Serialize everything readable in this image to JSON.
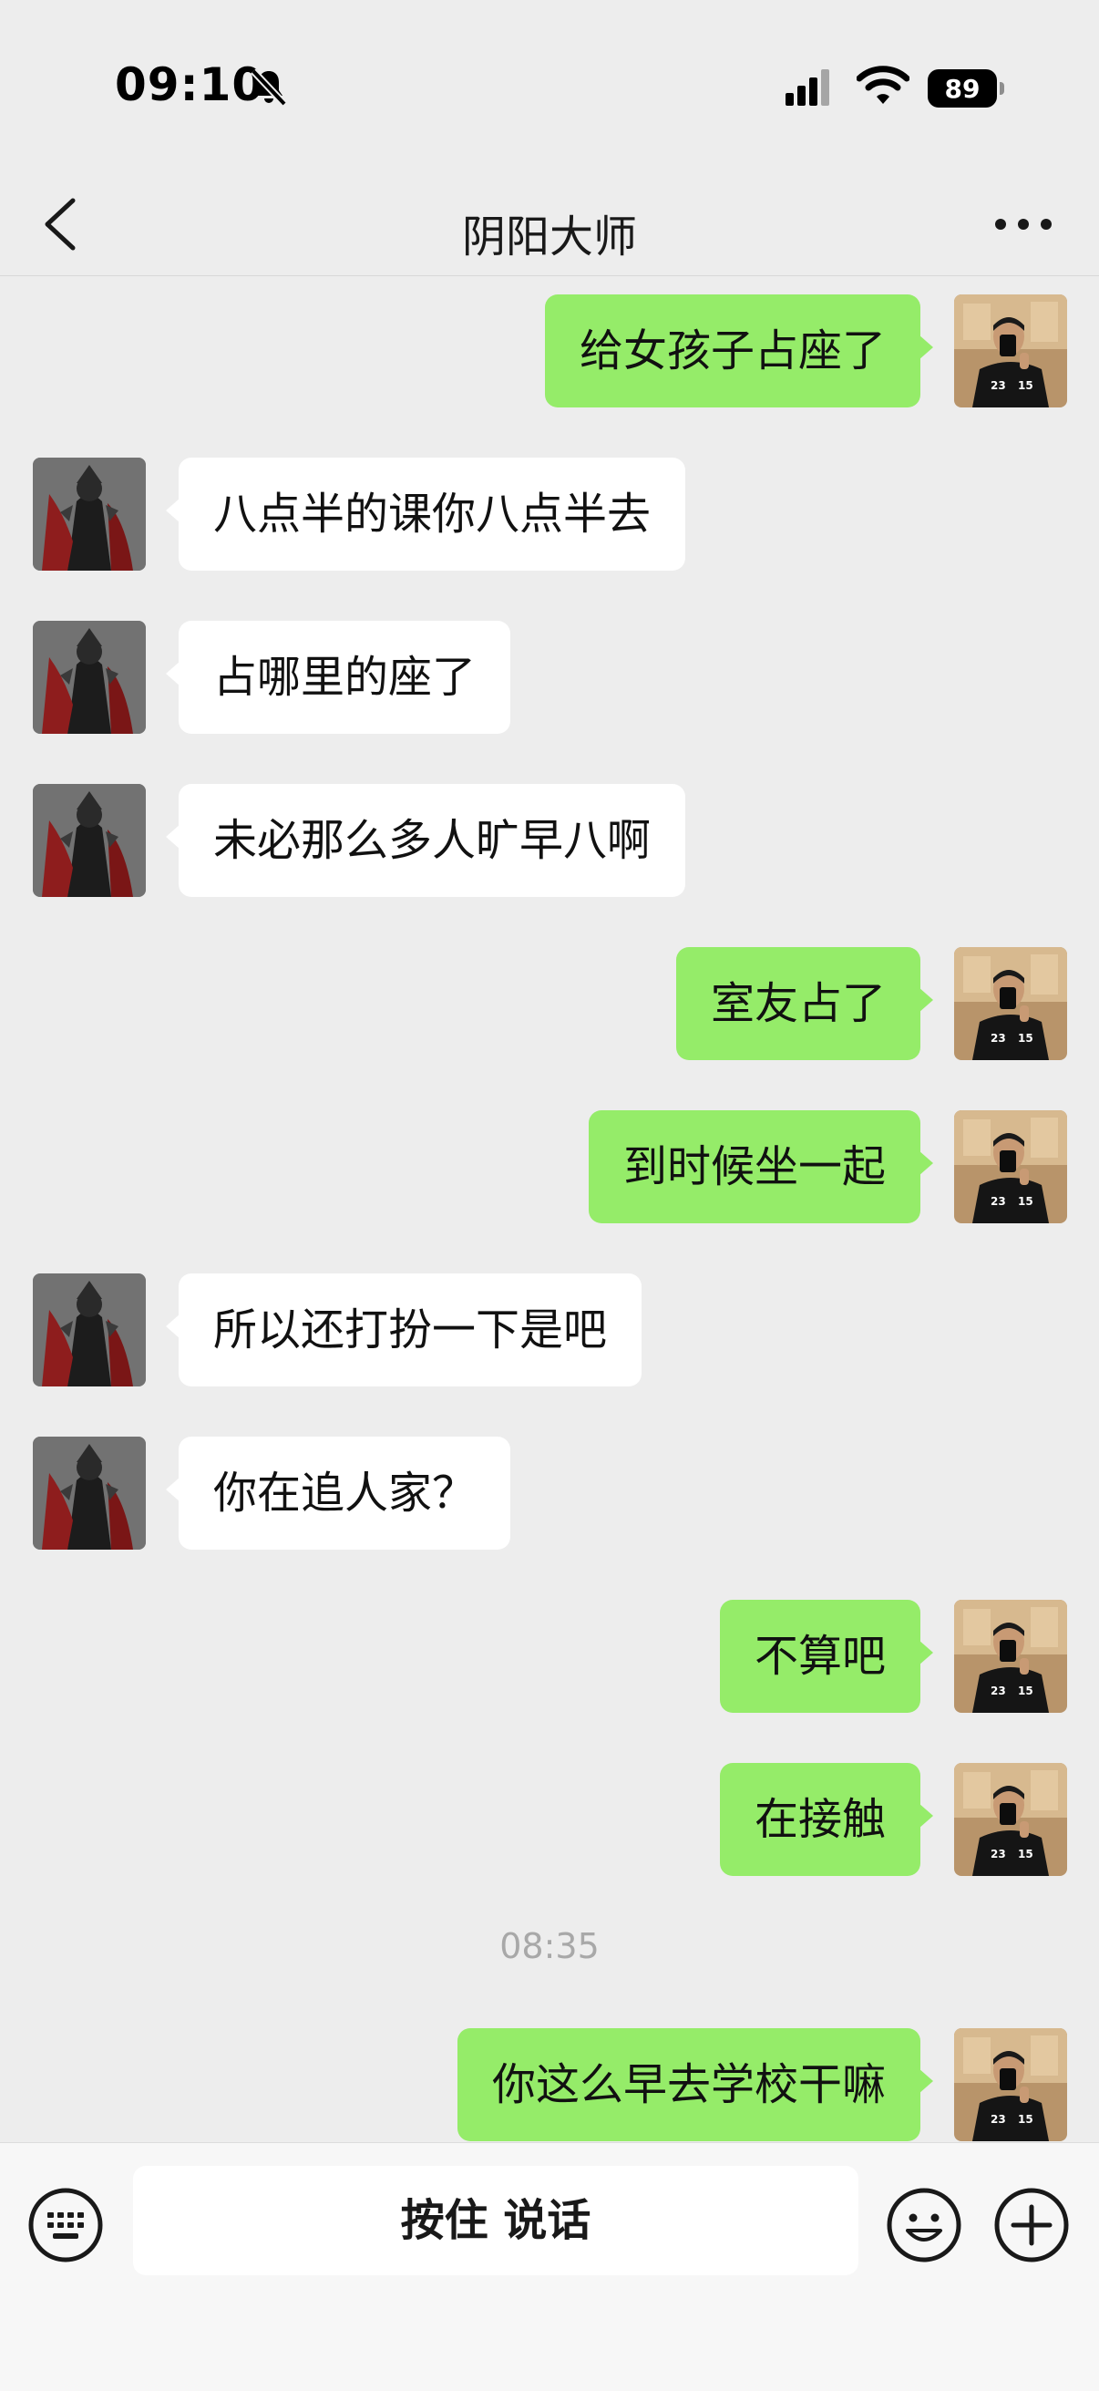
{
  "status_bar": {
    "time": "09:10",
    "battery": "89",
    "icons": [
      "bell-slash-icon",
      "cellular-signal-icon",
      "wifi-icon",
      "battery-icon"
    ]
  },
  "nav": {
    "title": "阴阳大师",
    "back_icon": "chevron-left-icon",
    "more_icon": "more-dots-icon"
  },
  "messages": [
    {
      "side": "out",
      "text": "给女孩子占座了"
    },
    {
      "side": "in",
      "text": "八点半的课你八点半去"
    },
    {
      "side": "in",
      "text": "占哪里的座了"
    },
    {
      "side": "in",
      "text": "未必那么多人旷早八啊"
    },
    {
      "side": "out",
      "text": "室友占了"
    },
    {
      "side": "out",
      "text": "到时候坐一起"
    },
    {
      "side": "in",
      "text": "所以还打扮一下是吧"
    },
    {
      "side": "in",
      "text": "你在追人家？"
    },
    {
      "side": "out",
      "text": "不算吧"
    },
    {
      "side": "out",
      "text": "在接触"
    },
    {
      "timestamp": "08:35"
    },
    {
      "side": "out",
      "text": "你这么早去学校干嘛"
    }
  ],
  "input_bar": {
    "voice_label": "按住 说话",
    "icons": [
      "keyboard-icon",
      "emoji-icon",
      "plus-icon"
    ]
  },
  "colors": {
    "background": "#ededed",
    "outgoing_bubble": "#95ec69",
    "incoming_bubble": "#ffffff",
    "input_bar": "#f7f7f7"
  }
}
